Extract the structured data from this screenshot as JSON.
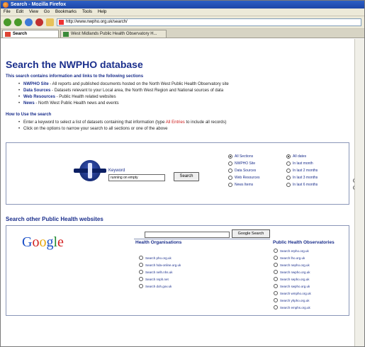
{
  "window": {
    "title": "Search - Mozilla Firefox"
  },
  "menu": [
    "File",
    "Edit",
    "View",
    "Go",
    "Bookmarks",
    "Tools",
    "Help"
  ],
  "url": "http://www.nwpho.org.uk/search/",
  "tabs": [
    {
      "label": "Search"
    },
    {
      "label": "West Midlands Public Health Observatory H..."
    }
  ],
  "page": {
    "title": "Search the NWPHO database",
    "intro": "This search contains information and links to the following sections",
    "sections": [
      {
        "name": "NWPHO Site",
        "desc": " - All reports and published documents hosted on the North West Public Health Observatory site"
      },
      {
        "name": "Data Sources",
        "desc": " - Datasets relevant to your Local area, the North West Region and National sources of data"
      },
      {
        "name": "Web Resources",
        "desc": " - Public Health related websites"
      },
      {
        "name": "News",
        "desc": " - North West Public Health news and events"
      }
    ],
    "howto_title": "How to Use the search",
    "howto_1a": "Enter a keyword to select a list of datasets containing that information (type ",
    "howto_1b": "All Entries",
    "howto_1c": " to include all records)",
    "howto_2": "Click on the options to narrow your search to all sections or one of the above"
  },
  "search": {
    "keyword_label": "Keyword",
    "keyword_value": "running on empty",
    "button": "Search",
    "sections": [
      "All Sections",
      "NWPHO Site",
      "Data Sources",
      "Web Resources",
      "News Items"
    ],
    "dates": [
      "All dates",
      "In last month",
      "In last 2 months",
      "In last 3 months",
      "In last 6 months"
    ]
  },
  "other": {
    "title": "Search other Public Health websites",
    "google_letters": [
      "G",
      "o",
      "o",
      "g",
      "l",
      "e"
    ],
    "google_button": "Google Search",
    "col1_title": "Health Organisations",
    "col1_items": [
      "Search pho.org.uk",
      "Search hda-online.org.uk",
      "Search nelh.nhs.uk",
      "Search nsph.net",
      "Search doh.gov.uk"
    ],
    "col2_title": "Public Health Observatories",
    "col2_items": [
      "Search erpho.org.uk",
      "Search lho.org.uk",
      "Search nepho.org.uk",
      "Search nwpho.org.uk",
      "Search sepho.org.uk",
      "Search swpho.org.uk",
      "Search wmpho.org.uk",
      "Search yhpho.org.uk",
      "Search emphs.org.uk"
    ]
  },
  "colors": {
    "heading": "#1b2f8c",
    "accent_red": "#cc1a1a"
  }
}
